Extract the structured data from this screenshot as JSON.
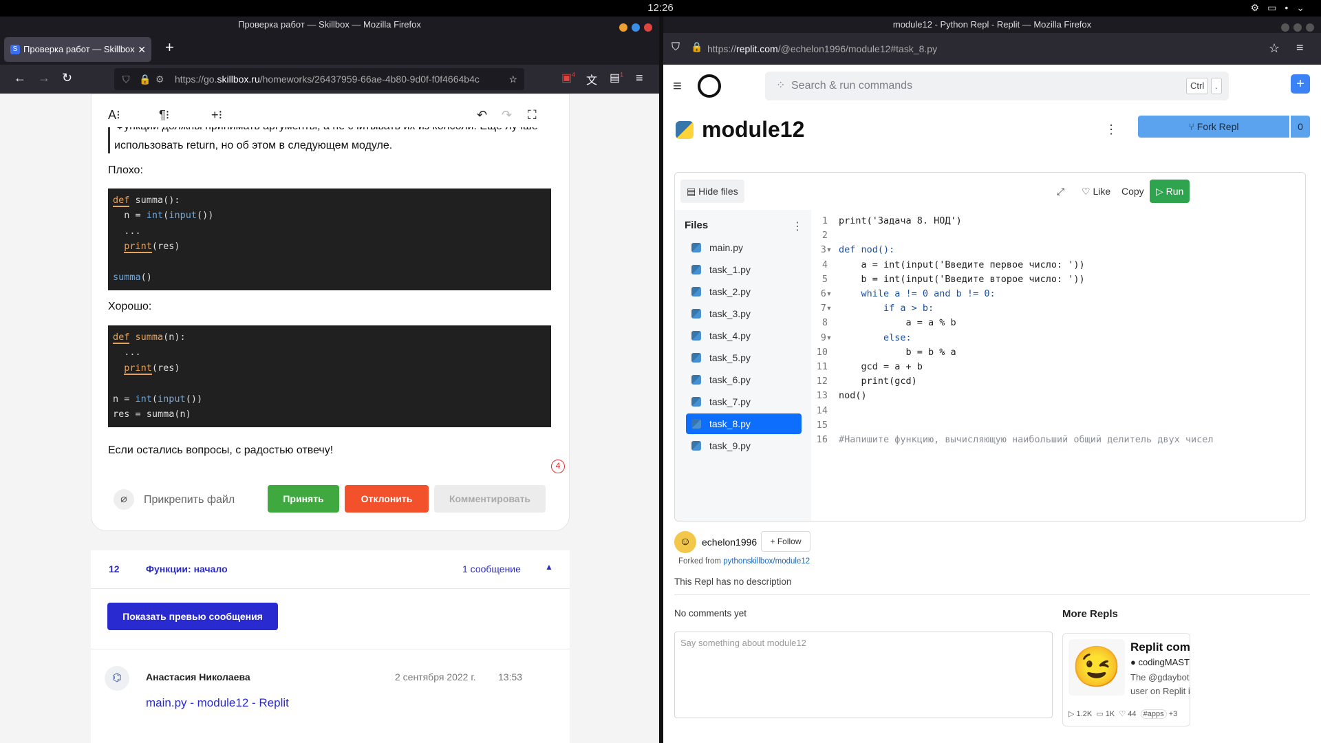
{
  "system": {
    "clock": "12:26"
  },
  "left_window": {
    "title": "Проверка работ — Skillbox — Mozilla Firefox",
    "tab_title": "Проверка работ — Skillbox",
    "tab_favicon": "S",
    "url_prefix": "https://go.",
    "url_domain": "skillbox.ru",
    "url_path": "/homeworks/26437959-66ae-4b80-9d0f-f0f4664b4c",
    "badge_ext1": "4",
    "badge_ext2": "1"
  },
  "review": {
    "partial_top_line": "Функции должны принимать аргументы, а не считывать их из консоли. Еще лучше",
    "line2": "использовать return, но об этом в следующем модуле.",
    "bad_label": "Плохо:",
    "bad_code": [
      "def summa():",
      "  n = int(input())",
      "  ...",
      "  print(res)",
      "",
      "summa()"
    ],
    "good_label": "Хорошо:",
    "good_code": [
      "def summa(n):",
      "  ...",
      "  print(res)",
      "",
      "n = int(input())",
      "res = summa(n)"
    ],
    "closing": "Если остались вопросы, с радостью отвечу!",
    "counter": "4",
    "attach": "Прикрепить файл",
    "accept": "Принять",
    "reject": "Отклонить",
    "comment": "Комментировать"
  },
  "lesson": {
    "number": "12",
    "title": "Функции: начало",
    "messages": "1 сообщение",
    "preview_button": "Показать превью сообщения"
  },
  "message": {
    "author": "Анастасия Николаева",
    "date": "2 сентября 2022 г.",
    "time": "13:53",
    "link": "main.py - module12 - Replit"
  },
  "right_window": {
    "title": "module12 - Python Repl - Replit — Mozilla Firefox",
    "url_prefix": "https://",
    "url_domain": "replit.com",
    "url_path": "/@echelon1996/module12#task_8.py"
  },
  "replit": {
    "search_placeholder": "Search & run commands",
    "key1": "Ctrl",
    "key2": ".",
    "repl_name": "module12",
    "fork": "Fork Repl",
    "fork_count": "0",
    "hide_files": "Hide files",
    "like": "Like",
    "copy": "Copy",
    "run": "Run",
    "files_header": "Files",
    "files": [
      "main.py",
      "task_1.py",
      "task_2.py",
      "task_3.py",
      "task_4.py",
      "task_5.py",
      "task_6.py",
      "task_7.py",
      "task_8.py",
      "task_9.py"
    ],
    "active_file": "task_8.py",
    "code_lines": [
      "print('Задача 8. НОД')",
      "",
      "def nod():",
      "    a = int(input('Введите первое число: '))",
      "    b = int(input('Введите второе число: '))",
      "    while a != 0 and b != 0:",
      "        if a > b:",
      "            a = a % b",
      "        else:",
      "            b = b % a",
      "    gcd = a + b",
      "    print(gcd)",
      "nod()",
      "",
      "",
      "#Напишите функцию, вычисляющую наибольший общий делитель двух чисел"
    ],
    "owner": "echelon1996",
    "follow": "Follow",
    "forked_from_label": "Forked from ",
    "forked_from": "pythonskillbox/module12",
    "description": "This Repl has no description",
    "no_comments": "No comments yet",
    "comment_placeholder": "Say something about module12",
    "more_repls": "More Repls",
    "card_title": "Replit com...",
    "card_author": "codingMASTE...",
    "card_desc1": "The @gdaybot",
    "card_desc2": "user on Replit is ...",
    "card_runs": "1.2K",
    "card_comments": "1K",
    "card_likes": "44",
    "card_tag": "#apps",
    "card_more": "+3"
  },
  "colors": {
    "accept": "#3fa93f",
    "reject": "#f3512b",
    "lesson_blue": "#2a2ad1",
    "replit_blue": "#4c9ae6",
    "run_green": "#2ea44f",
    "active_file": "#0d6efd"
  }
}
